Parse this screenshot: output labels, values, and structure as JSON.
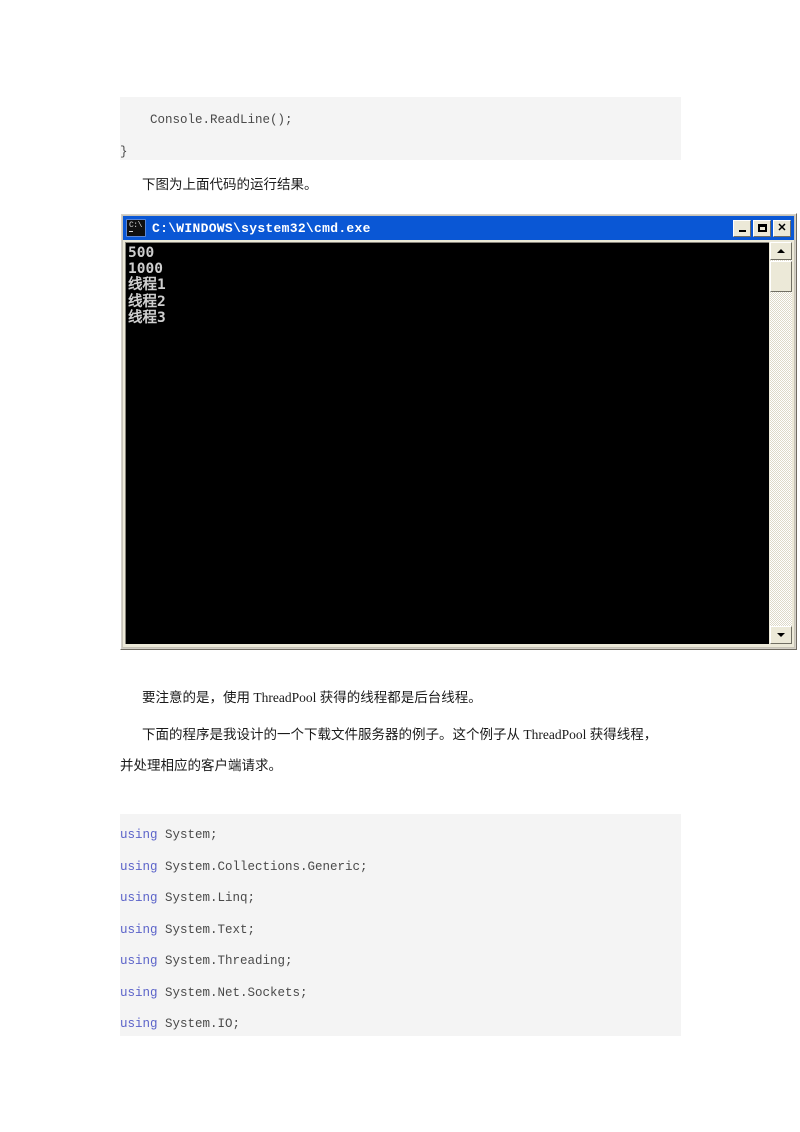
{
  "document": {
    "code_block_top": {
      "lines": [
        "    Console.ReadLine();",
        "}"
      ]
    },
    "paragraphs": [
      {
        "id": "p1",
        "text": "下图为上面代码的运行结果。"
      },
      {
        "id": "p2",
        "text": "要注意的是，使用 ThreadPool 获得的线程都是后台线程。"
      },
      {
        "id": "p3",
        "text": "下面的程序是我设计的一个下载文件服务器的例子。这个例子从 ThreadPool 获得线程，"
      },
      {
        "id": "p4",
        "text": "并处理相应的客户端请求。"
      }
    ],
    "code_block_bottom": {
      "keyword": "using",
      "lines": [
        {
          "kw": "using",
          "rest": " System;"
        },
        {
          "kw": "using",
          "rest": " System.Collections.Generic;"
        },
        {
          "kw": "using",
          "rest": " System.Linq;"
        },
        {
          "kw": "using",
          "rest": " System.Text;"
        },
        {
          "kw": "using",
          "rest": " System.Threading;"
        },
        {
          "kw": "using",
          "rest": " System.Net.Sockets;"
        },
        {
          "kw": "using",
          "rest": " System.IO;"
        }
      ]
    }
  },
  "console_window": {
    "title": "C:\\WINDOWS\\system32\\cmd.exe",
    "icon": "cmd-console-icon",
    "titlebar_color": "#0a57d5",
    "screen_background": "#000000",
    "screen_foreground": "#cfcfcf",
    "buttons": {
      "minimize": "_",
      "maximize": "□",
      "close": "✕"
    },
    "output_lines": [
      "500",
      "1000",
      "线程1",
      "线程2",
      "线程3"
    ],
    "scrollbar": {
      "up_arrow": "▲",
      "down_arrow": "▼"
    }
  }
}
